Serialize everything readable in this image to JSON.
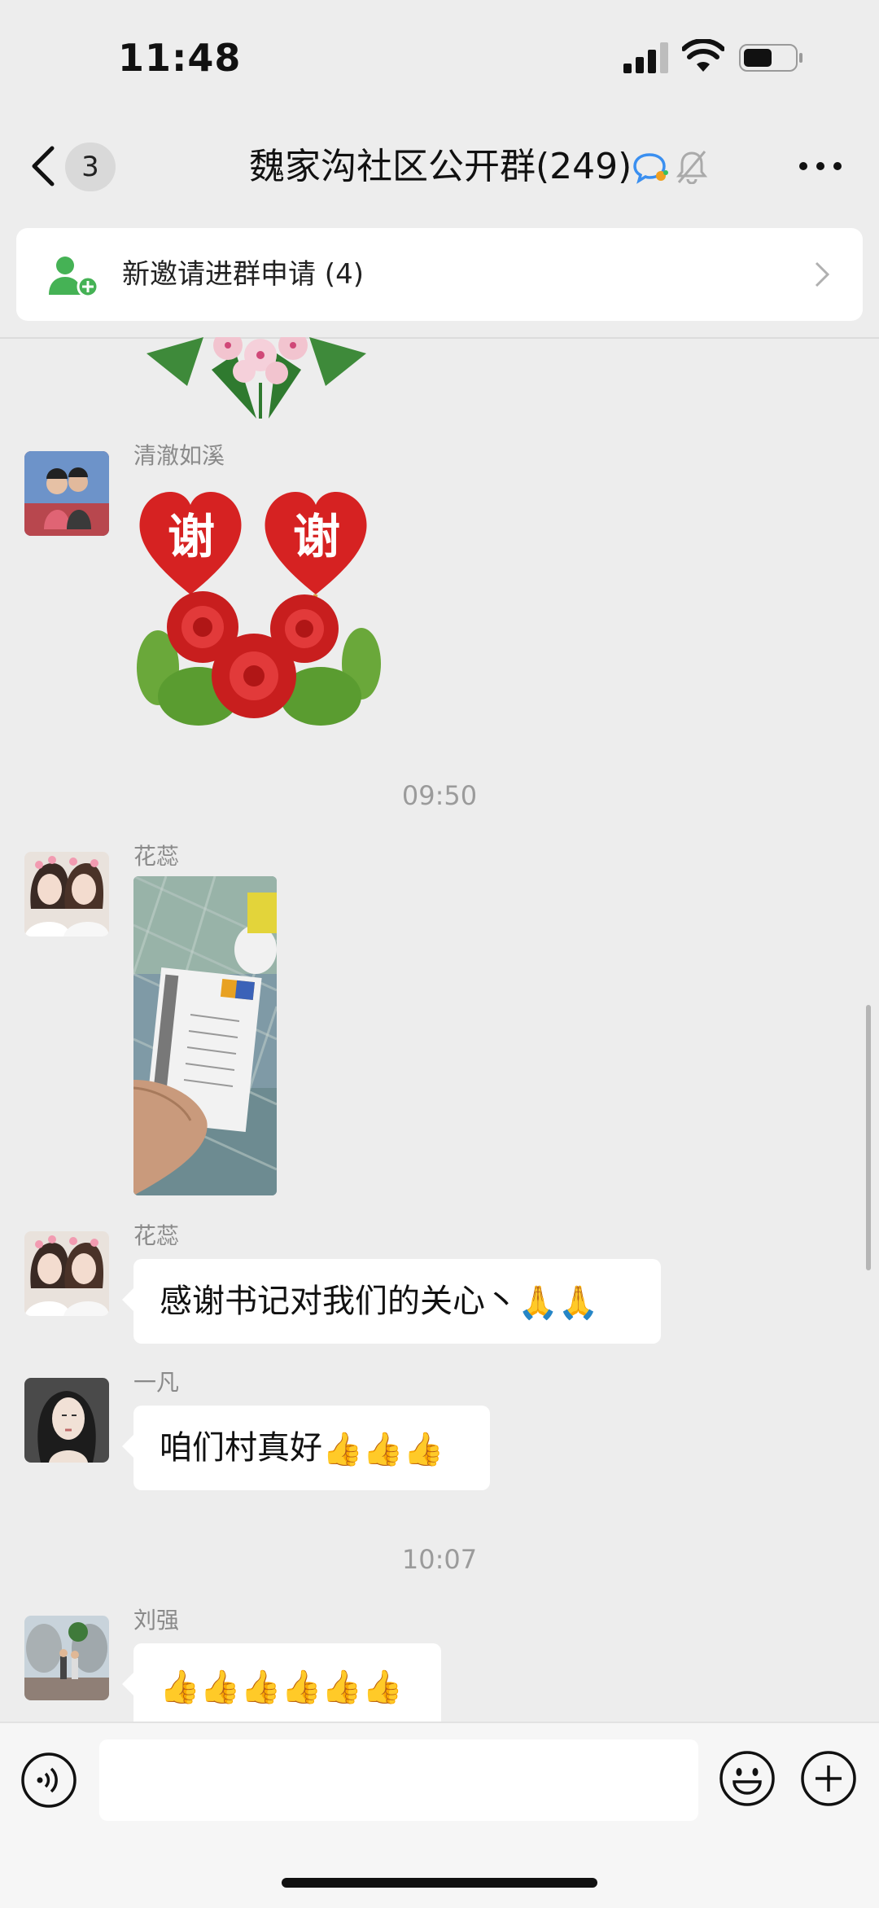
{
  "status_bar": {
    "time": "11:48"
  },
  "nav": {
    "back_count": "3",
    "title": "魏家沟社区公开群(249)"
  },
  "invite_banner": {
    "label": "新邀请进群申请 (4)"
  },
  "messages": [
    {
      "sender": "清澈如溪",
      "sticker_text": [
        "谢",
        "谢"
      ]
    },
    {
      "sender": "花蕊"
    },
    {
      "sender": "花蕊",
      "text": "感谢书记对我们的关心丶",
      "emoji": [
        "🙏",
        "🙏"
      ]
    },
    {
      "sender": "一凡",
      "text": "咱们村真好",
      "emoji": [
        "👍",
        "👍",
        "👍"
      ]
    },
    {
      "sender": "刘强",
      "emoji": [
        "👍",
        "👍",
        "👍",
        "👍",
        "👍",
        "👍"
      ]
    }
  ],
  "time_separators": [
    "09:50",
    "10:07"
  ],
  "input_bar": {
    "placeholder": ""
  },
  "colors": {
    "background": "#ededed",
    "bubble": "#ffffff",
    "invite_icon": "#45b255",
    "sticker_red": "#d62222"
  }
}
